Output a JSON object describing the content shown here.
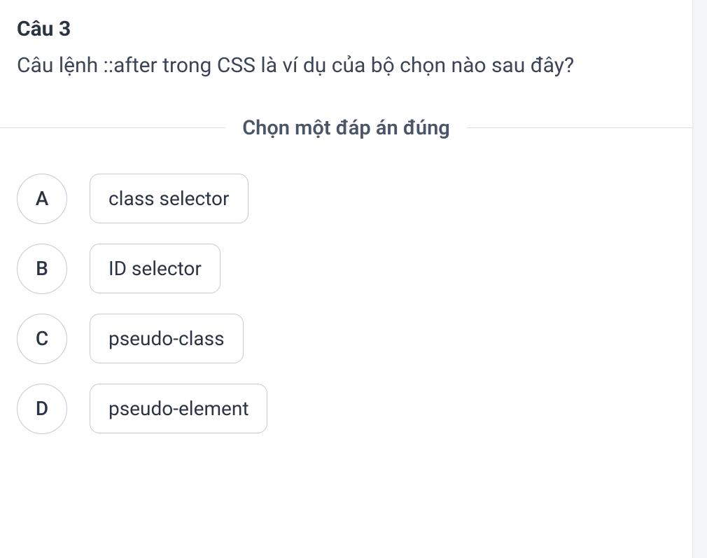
{
  "question": {
    "number_label": "Câu 3",
    "text": "Câu lệnh ::after trong CSS là ví dụ của bộ chọn nào sau đây?",
    "instruction": "Chọn một đáp án đúng",
    "options": [
      {
        "letter": "A",
        "text": "class selector"
      },
      {
        "letter": "B",
        "text": "ID selector"
      },
      {
        "letter": "C",
        "text": "pseudo-class"
      },
      {
        "letter": "D",
        "text": "pseudo-element"
      }
    ]
  }
}
